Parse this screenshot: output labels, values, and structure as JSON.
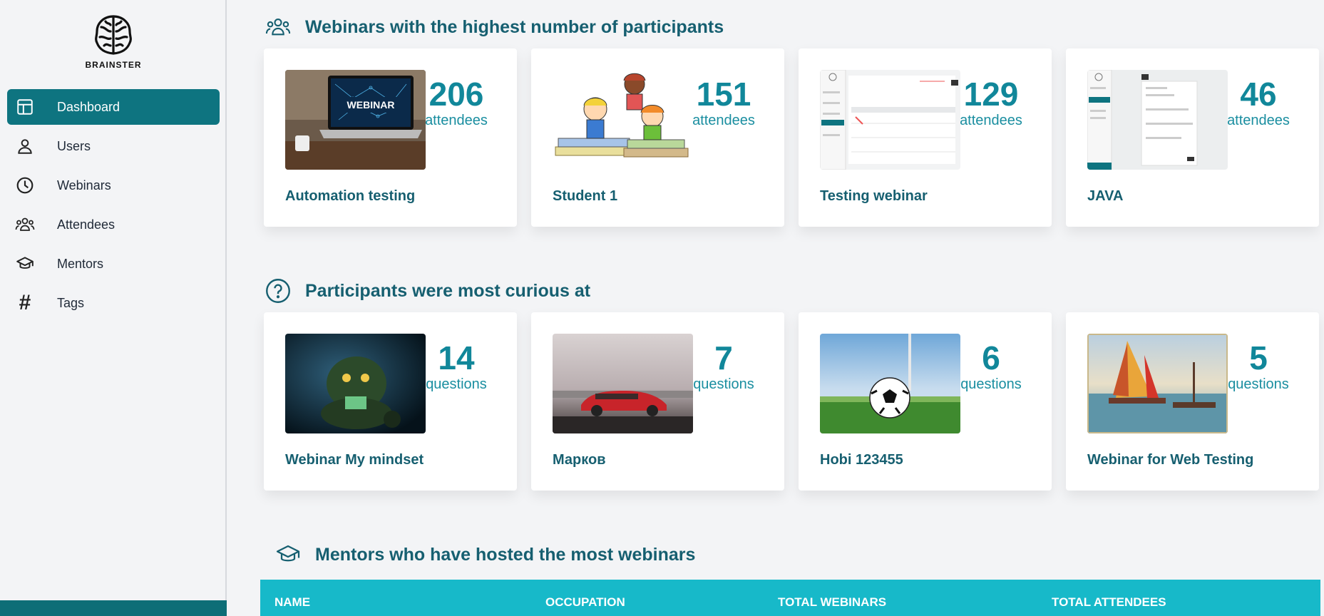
{
  "brand": {
    "name": "BRAINSTER"
  },
  "sidebar": {
    "items": [
      {
        "label": "Dashboard",
        "icon": "dashboard-icon",
        "active": true
      },
      {
        "label": "Users",
        "icon": "user-icon"
      },
      {
        "label": "Webinars",
        "icon": "clock-icon"
      },
      {
        "label": "Attendees",
        "icon": "group-icon"
      },
      {
        "label": "Mentors",
        "icon": "graduation-cap-icon"
      },
      {
        "label": "Tags",
        "icon": "hashtag-icon"
      }
    ]
  },
  "sections": {
    "participants": {
      "title": "Webinars with the highest number of participants",
      "cards": [
        {
          "name": "Automation testing",
          "value": "206",
          "unit": "attendees"
        },
        {
          "name": "Student 1",
          "value": "151",
          "unit": "attendees"
        },
        {
          "name": "Testing webinar",
          "value": "129",
          "unit": "attendees"
        },
        {
          "name": "JAVA",
          "value": "46",
          "unit": "attendees"
        }
      ]
    },
    "curious": {
      "title": "Participants were most curious at",
      "cards": [
        {
          "name": "Webinar My mindset",
          "value": "14",
          "unit": "questions"
        },
        {
          "name": "Марков",
          "value": "7",
          "unit": "questions"
        },
        {
          "name": "Hobi 123455",
          "value": "6",
          "unit": "questions"
        },
        {
          "name": "Webinar for Web Testing",
          "value": "5",
          "unit": "questions"
        }
      ]
    },
    "mentors": {
      "title": "Mentors who have hosted the most webinars",
      "columns": [
        "NAME",
        "OCCUPATION",
        "TOTAL WEBINARS",
        "TOTAL ATTENDEES"
      ]
    }
  },
  "thumb_labels": {
    "webinar_laptop": "WEBINAR"
  },
  "colors": {
    "accent": "#0e7480",
    "heading": "#165f70",
    "number": "#11879a",
    "table_header": "#17b9c9"
  }
}
